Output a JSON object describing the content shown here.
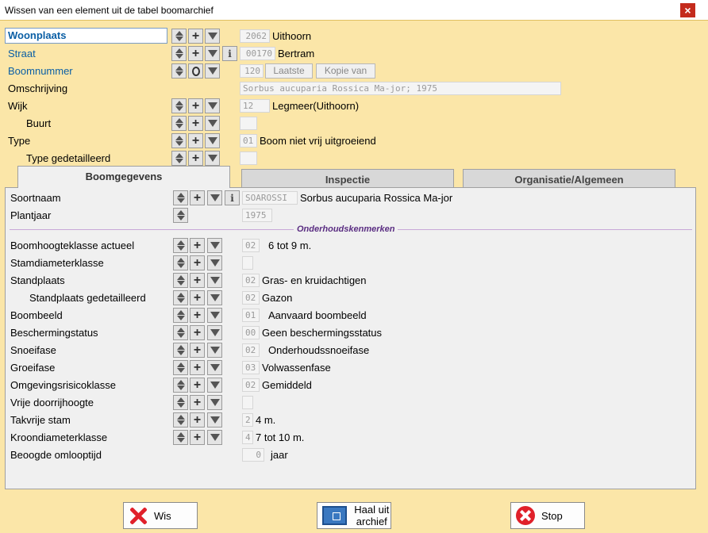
{
  "window": {
    "title": "Wissen van een element uit de tabel boomarchief",
    "close_label": "×"
  },
  "header_fields": {
    "woonplaats": {
      "label": "Woonplaats",
      "code": "2062",
      "value": "Uithoorn"
    },
    "straat": {
      "label": "Straat",
      "code": "00170",
      "value": "Bertram"
    },
    "boomnummer": {
      "label": "Boomnummer",
      "code": "120",
      "laatste": "Laatste",
      "kopie_van": "Kopie van"
    },
    "omschrijving": {
      "label": "Omschrijving",
      "value": "Sorbus aucuparia Rossica Ma-jor; 1975"
    },
    "wijk": {
      "label": "Wijk",
      "code": "12",
      "value": "Legmeer(Uithoorn)"
    },
    "buurt": {
      "label": "Buurt",
      "code": ""
    },
    "type": {
      "label": "Type",
      "code": "01",
      "value": "Boom niet vrij uitgroeiend"
    },
    "type_gedetailleerd": {
      "label": "Type gedetailleerd",
      "code": ""
    }
  },
  "tabs": [
    {
      "label": "Boomgegevens",
      "active": true
    },
    {
      "label": "Inspectie",
      "active": false
    },
    {
      "label": "Organisatie/Algemeen",
      "active": false
    }
  ],
  "boomgegevens": {
    "soortnaam": {
      "label": "Soortnaam",
      "code": "SOAROSSI",
      "value": "Sorbus aucuparia Rossica Ma-jor"
    },
    "plantjaar": {
      "label": "Plantjaar",
      "code": "1975"
    },
    "section_title": "Onderhoudskenmerken",
    "rows": [
      {
        "label": "Boomhoogteklasse actueel",
        "code": "02",
        "value": "6 tot 9 m."
      },
      {
        "label": "Stamdiameterklasse",
        "code": "",
        "value": ""
      },
      {
        "label": "Standplaats",
        "code": "02",
        "value": "Gras- en kruidachtigen"
      },
      {
        "label": "Standplaats gedetailleerd",
        "code": "02",
        "value": "Gazon"
      },
      {
        "label": "Boombeeld",
        "code": "01",
        "value": "Aanvaard boombeeld"
      },
      {
        "label": "Beschermingstatus",
        "code": "00",
        "value": "Geen beschermingsstatus"
      },
      {
        "label": "Snoeifase",
        "code": "02",
        "value": "Onderhoudssnoeifase"
      },
      {
        "label": "Groeifase",
        "code": "03",
        "value": "Volwassenfase"
      },
      {
        "label": "Omgevingsrisicoklasse",
        "code": "02",
        "value": "Gemiddeld"
      },
      {
        "label": "Vrije doorrijhoogte",
        "code": "",
        "value": ""
      },
      {
        "label": "Takvrije stam",
        "code": "2",
        "value": "4 m."
      },
      {
        "label": "Kroondiameterklasse",
        "code": "4",
        "value": "7 tot 10 m."
      },
      {
        "label": "Beoogde omlooptijd",
        "code": "0",
        "value": "jaar"
      }
    ]
  },
  "buttons": {
    "wis": "Wis",
    "haal_uit_archief": "Haal uit archief",
    "stop": "Stop"
  },
  "colors": {
    "background": "#fbe6a8",
    "panel": "#f0f0f0",
    "link": "#0b5fa5",
    "section": "#5a2d82",
    "danger": "#e0202a"
  }
}
